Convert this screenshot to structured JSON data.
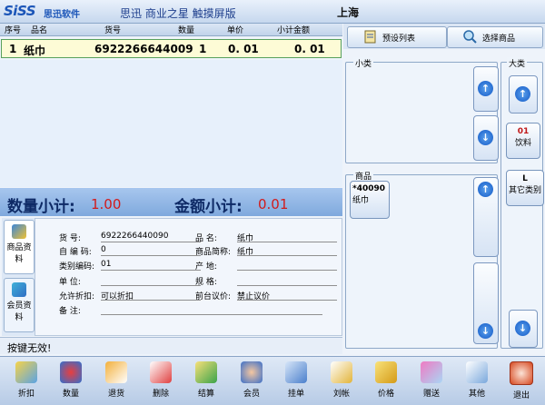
{
  "header": {
    "logo": "SiSS",
    "logo_sub": "思迅软件",
    "app_title": "思迅  商业之星  触摸屏版",
    "location": "上海"
  },
  "grid": {
    "columns": [
      "序号",
      "品名",
      "货号",
      "数量",
      "单价",
      "小计金额"
    ],
    "rows": [
      {
        "seq": "1",
        "name": "纸巾",
        "code": "6922266644009",
        "qty": "1",
        "price": "0. 01",
        "subtotal": "0. 01"
      }
    ]
  },
  "totals": {
    "qty_label": "数量小计:",
    "qty_value": "1.00",
    "amount_label": "金额小计:",
    "amount_value": "0.01"
  },
  "side_tabs": [
    "商品资料",
    "会员资料"
  ],
  "info": {
    "left": [
      {
        "label": "货    号:",
        "value": "6922266440090"
      },
      {
        "label": "自 编 码:",
        "value": "0"
      },
      {
        "label": "类别编码:",
        "value": "01"
      },
      {
        "label": "单    位:",
        "value": ""
      },
      {
        "label": "允许折扣:",
        "value": "可以折扣"
      },
      {
        "label": "备    注:",
        "value": ""
      }
    ],
    "right": [
      {
        "label": "品    名:",
        "value": "纸巾"
      },
      {
        "label": "商品简称:",
        "value": "纸巾"
      },
      {
        "label": "产    地:",
        "value": ""
      },
      {
        "label": "规    格:",
        "value": ""
      },
      {
        "label": "前台议价:",
        "value": "禁止议价"
      }
    ]
  },
  "status": "按键无效!",
  "right_panel": {
    "tabs": [
      "预设列表",
      "选择商品"
    ],
    "groups": {
      "subcategory": "小类",
      "category": "大类",
      "products": "商品"
    },
    "category_cards": [
      {
        "code": "01",
        "name": "饮料"
      },
      {
        "code": "L",
        "name": "其它类别"
      }
    ],
    "product_cards": [
      {
        "code": "*40090",
        "name": "纸巾"
      }
    ]
  },
  "toolbar": [
    "折扣",
    "数量",
    "退货",
    "删除",
    "结算",
    "会员",
    "挂单",
    "刘帐",
    "价格",
    "赠送",
    "其他",
    "退出"
  ],
  "colors": {
    "accent": "#1359c7",
    "total_value": "#d21b1b"
  }
}
